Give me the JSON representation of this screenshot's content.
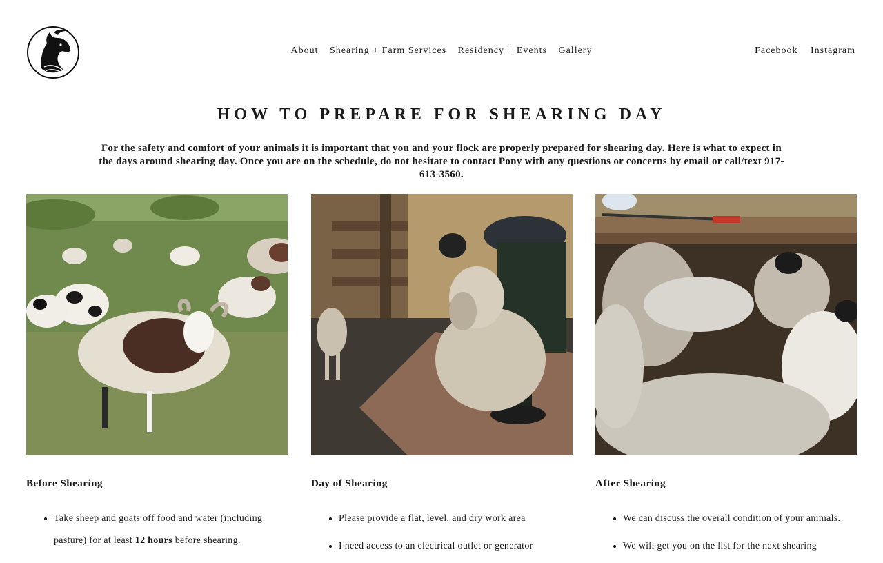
{
  "brand": {
    "logo_icon": "horse-head-logo"
  },
  "nav": {
    "main": [
      "About",
      "Shearing + Farm Services",
      "Residency + Events",
      "Gallery"
    ],
    "social": [
      "Facebook",
      "Instagram"
    ]
  },
  "page": {
    "title": "HOW TO PREPARE FOR SHEARING DAY",
    "intro": "For the safety and comfort of your animals it is important that you and your flock are properly prepared for shearing day. Here is what to expect in the days around shearing day. Once you are on the schedule, do not hesitate to contact Pony with any questions or concerns by email or call/text 917-613-3560."
  },
  "sections": [
    {
      "heading": "Before Shearing",
      "items": [
        {
          "pre": "Take sheep and goats off food and water (including pasture) for at least ",
          "bold": "12 hours",
          "post": " before shearing."
        }
      ]
    },
    {
      "heading": "Day of Shearing",
      "items": [
        {
          "pre": "Please provide a flat, level, and dry work area",
          "bold": "",
          "post": ""
        },
        {
          "pre": "I need access to an electrical outlet or generator",
          "bold": "",
          "post": ""
        }
      ]
    },
    {
      "heading": "After Shearing",
      "items": [
        {
          "pre": "We can discuss the overall condition of your animals.",
          "bold": "",
          "post": ""
        },
        {
          "pre": "We will get you on the list for the next shearing",
          "bold": "",
          "post": ""
        }
      ]
    }
  ],
  "colors": {
    "text": "#1a1a1a",
    "background": "#ffffff"
  }
}
